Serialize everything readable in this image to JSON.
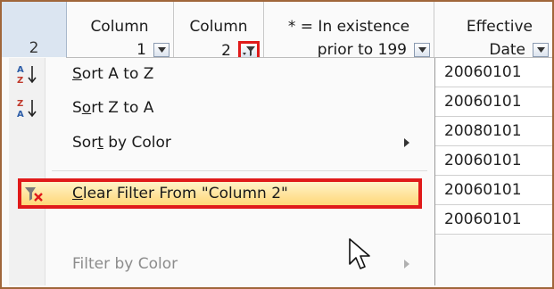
{
  "header": {
    "row_number": "2",
    "columns": [
      {
        "line1": "Column",
        "line2": "1"
      },
      {
        "line1": "Column",
        "line2": "2"
      },
      {
        "line1": "* = In existence",
        "line2": "prior to 199"
      },
      {
        "line1": "Effective",
        "line2": "Date"
      }
    ]
  },
  "values": [
    "20060101",
    "20060101",
    "20080101",
    "20060101",
    "20060101",
    "20060101"
  ],
  "menu": {
    "sort_az": {
      "prefix": "",
      "key": "S",
      "rest": "ort A to Z"
    },
    "sort_za": {
      "prefix": "S",
      "key": "o",
      "rest": "rt Z to A"
    },
    "sort_color": {
      "prefix": "Sor",
      "key": "t",
      "rest": " by Color"
    },
    "clear_filter": {
      "prefix": "",
      "key": "C",
      "rest": "lear Filter From \"Column 2\""
    },
    "filter_color": {
      "label": "Filter by Color"
    }
  },
  "icons": {
    "sort_az": "sort-ascending-icon",
    "sort_za": "sort-descending-icon",
    "clear_filter": "clear-filter-icon",
    "filter_button": "filter-funnel-icon",
    "dropdown": "chevron-down-icon",
    "cursor": "mouse-pointer-icon"
  },
  "colors": {
    "highlight_border": "#e01a1a",
    "highlight_fill": "#ffd778",
    "rownum_bg": "#dbe5f1",
    "frame_border": "#a0663a"
  }
}
